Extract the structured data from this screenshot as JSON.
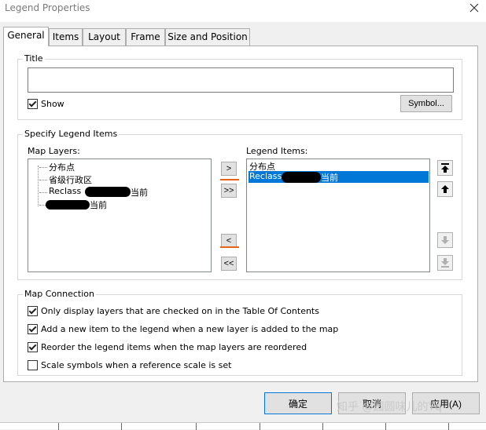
{
  "window": {
    "title": "Legend Properties"
  },
  "tabs": [
    {
      "label": "General",
      "active": true
    },
    {
      "label": "Items"
    },
    {
      "label": "Layout"
    },
    {
      "label": "Frame"
    },
    {
      "label": "Size and Position"
    }
  ],
  "title_group": {
    "label": "Title",
    "title_value": "",
    "show_label": "Show",
    "show_checked": true,
    "symbol_button": "Symbol..."
  },
  "legend_items_group": {
    "label": "Specify Legend Items",
    "map_layers_label": "Map Layers:",
    "map_layers": [
      "分布点",
      "省级行政区",
      "Reclass",
      "当前",
      "当前"
    ],
    "legend_items_label": "Legend Items:",
    "legend_items": [
      "分布点",
      "Reclass",
      "当前"
    ],
    "add_button": ">",
    "add_all_button": ">>",
    "remove_button": "<",
    "remove_all_button": "<<"
  },
  "map_connection": {
    "label": "Map Connection",
    "options": [
      {
        "label": "Only display layers that are checked on in the Table Of Contents",
        "checked": true
      },
      {
        "label": "Add a new item to the legend when a new layer is added to the map",
        "checked": true
      },
      {
        "label": "Reorder the legend items when the map layers are reordered",
        "checked": true
      },
      {
        "label": "Scale symbols when a reference scale is set",
        "checked": false
      }
    ]
  },
  "footer": {
    "ok_label": "确定",
    "cancel_label": "取消",
    "apply_label": "应用(A)"
  },
  "watermark": "知乎 @圆圆味儿的Yq",
  "colors": {
    "selection": "#0078d7",
    "annotation": "#e8631a"
  },
  "icons": {
    "close": "close-icon",
    "move_top": "move-to-top-icon",
    "move_up": "move-up-icon",
    "move_down": "move-down-icon",
    "move_bottom": "move-to-bottom-icon"
  }
}
